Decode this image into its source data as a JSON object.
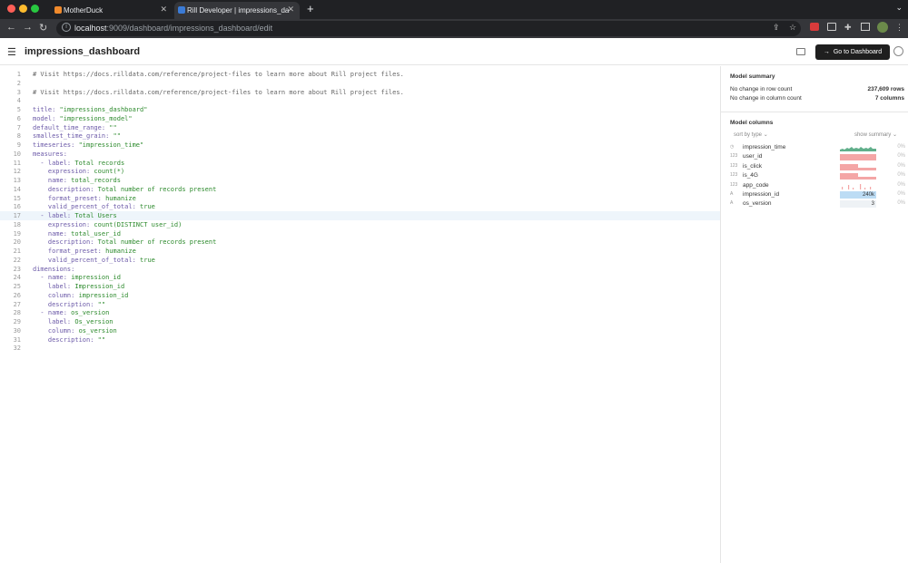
{
  "browser": {
    "tabs": [
      {
        "label": "MotherDuck",
        "active": false,
        "favicon_color": "#f08a2c"
      },
      {
        "label": "Rill Developer | impressions_da",
        "active": true,
        "favicon_color": "#3b7bd6"
      }
    ],
    "url_host": "localhost",
    "url_path": ":9009/dashboard/impressions_dashboard/edit"
  },
  "header": {
    "title": "impressions_dashboard",
    "go_to_dashboard_label": "Go to Dashboard"
  },
  "editor": {
    "active_line": 17,
    "lines": [
      "# Visit https://docs.rilldata.com/reference/project-files to learn more about Rill project files.",
      "",
      "# Visit https://docs.rilldata.com/reference/project-files to learn more about Rill project files.",
      "",
      "title: \"impressions_dashboard\"",
      "model: \"impressions_model\"",
      "default_time_range: \"\"",
      "smallest_time_grain: \"\"",
      "timeseries: \"impression_time\"",
      "measures:",
      "  - label: Total records",
      "    expression: count(*)",
      "    name: total_records",
      "    description: Total number of records present",
      "    format_preset: humanize",
      "    valid_percent_of_total: true",
      "  - label: Total Users",
      "    expression: count(DISTINCT user_id)",
      "    name: total_user_id",
      "    description: Total number of records present",
      "    format_preset: humanize",
      "    valid_percent_of_total: true",
      "dimensions:",
      "  - name: impression_id",
      "    label: Impression_id",
      "    column: impression_id",
      "    description: \"\"",
      "  - name: os_version",
      "    label: Os_version",
      "    column: os_version",
      "    description: \"\"",
      ""
    ]
  },
  "sidebar": {
    "summary_title": "Model summary",
    "row_count_label": "No change in row count",
    "row_count_value": "237,609 rows",
    "column_count_label": "No change in column count",
    "column_count_value": "7 columns",
    "columns_title": "Model columns",
    "sort_label": "sort by type",
    "show_summary_label": "show summary",
    "columns": [
      {
        "type": "time",
        "name": "impression_time",
        "pct": "0%",
        "viz": "sparkline",
        "color": "#3a9b6e"
      },
      {
        "type": "123",
        "name": "user_id",
        "pct": "0%",
        "viz": "hist",
        "color": "#f4a6a6"
      },
      {
        "type": "123",
        "name": "is_click",
        "pct": "0%",
        "viz": "hist2",
        "color": "#f4a6a6"
      },
      {
        "type": "123",
        "name": "is_4G",
        "pct": "0%",
        "viz": "hist2",
        "color": "#f4a6a6"
      },
      {
        "type": "123",
        "name": "app_code",
        "pct": "0%",
        "viz": "spikes",
        "color": "#f4a6a6"
      },
      {
        "type": "A",
        "name": "impression_id",
        "pct": "0%",
        "viz": "card",
        "card": "240k",
        "color": "#bcdcf4"
      },
      {
        "type": "A",
        "name": "os_version",
        "pct": "0%",
        "viz": "card",
        "card": "3",
        "color": "#eef2f5"
      }
    ]
  }
}
